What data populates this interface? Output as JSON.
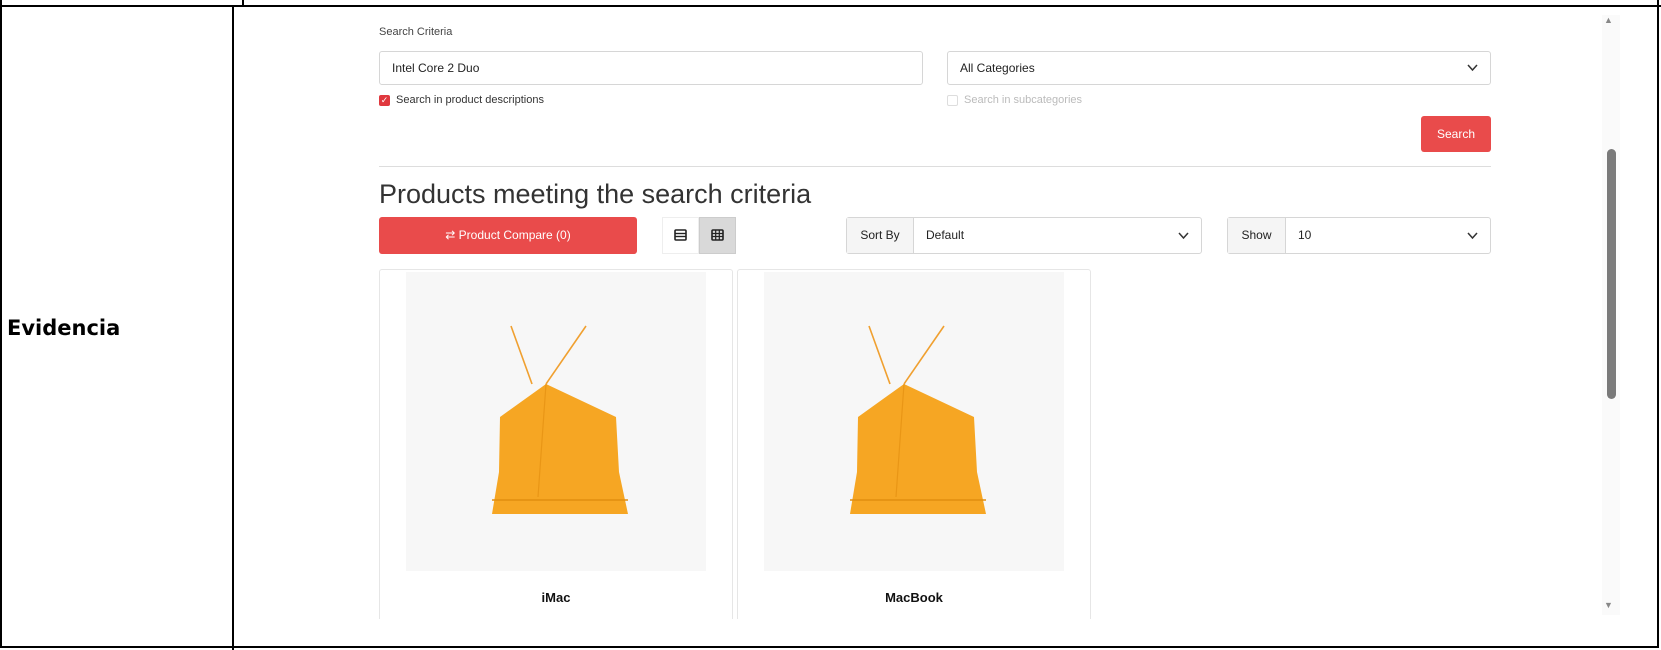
{
  "table": {
    "row_label": "Evidencia"
  },
  "search": {
    "criteria_label": "Search Criteria",
    "input_value": "Intel Core 2 Duo",
    "category_selected": "All Categories",
    "descriptions_label": "Search in product descriptions",
    "descriptions_checked": true,
    "subcategories_label": "Search in subcategories",
    "search_button": "Search"
  },
  "results": {
    "title": "Products meeting the search criteria",
    "compare_label": "⇄ Product Compare (0)",
    "sort_label": "Sort By",
    "sort_value": "Default",
    "show_label": "Show",
    "show_value": "10",
    "products": [
      {
        "name": "iMac"
      },
      {
        "name": "MacBook"
      }
    ]
  },
  "icons": {
    "list_view": "list-view-icon",
    "grid_view": "grid-view-icon",
    "chevron": "chevron-down-icon",
    "product_image": "orange-top-image"
  },
  "colors": {
    "accent": "#e94b4b",
    "product": "#f6a623"
  }
}
